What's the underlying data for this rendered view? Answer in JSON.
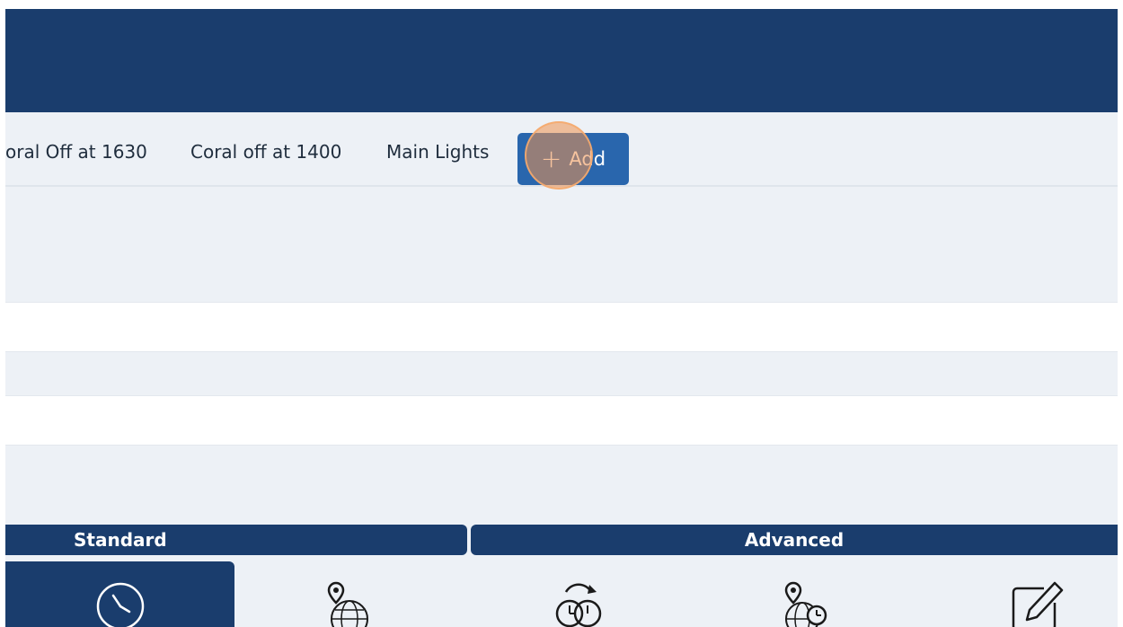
{
  "tabs": [
    {
      "label": "oral Off at 1630"
    },
    {
      "label": "Coral off at 1400"
    },
    {
      "label": "Main Lights"
    }
  ],
  "add_button": {
    "label": "Add",
    "icon": "plus-icon"
  },
  "sections": {
    "standard_label": "Standard",
    "advanced_label": "Advanced"
  },
  "modes": [
    {
      "icon": "clock-icon",
      "active": true
    },
    {
      "icon": "location-globe-icon",
      "active": false
    },
    {
      "icon": "timer-clock-icon",
      "active": false
    },
    {
      "icon": "location-globe-clock-icon",
      "active": false
    },
    {
      "icon": "edit-icon",
      "active": false
    }
  ],
  "colors": {
    "header": "#1a3d6d",
    "accent": "#2966ad",
    "background": "#edf1f6",
    "highlight": "#ee924e"
  }
}
